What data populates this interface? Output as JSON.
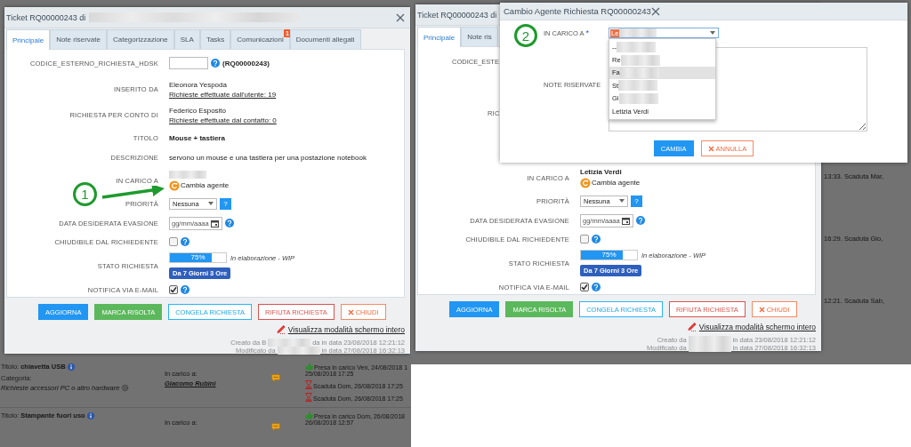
{
  "left": {
    "ticket": {
      "title": "Ticket RQ00000243 di",
      "title_redacted": true,
      "closable": true,
      "tabs": [
        {
          "label": "Principale",
          "selected": true
        },
        {
          "label": "Note riservate",
          "selected": false
        },
        {
          "label": "Categorizzazione",
          "selected": false
        },
        {
          "label": "SLA",
          "selected": false
        },
        {
          "label": "Tasks",
          "selected": false
        },
        {
          "label": "Comunicazioni",
          "selected": false,
          "badge": "1"
        },
        {
          "label": "Documenti allegati",
          "selected": false
        }
      ],
      "rows": [
        {
          "label": "CODICE_ESTERNO_RICHIESTA_HDSK",
          "kind": "code",
          "value": "(RQ00000243)"
        },
        {
          "label": "INSERITO DA",
          "kind": "person",
          "name": "Eleonora Yespoda",
          "link": "Richieste effettuate dall'utente: 19"
        },
        {
          "label": "RICHIESTA PER CONTO DI",
          "kind": "person",
          "name": "Federico Esposito",
          "link": "Richieste effettuate dal contatto: 0"
        },
        {
          "label": "TITOLO",
          "kind": "bold",
          "value": "Mouse + tastiera"
        },
        {
          "label": "DESCRIZIONE",
          "kind": "text",
          "value": "servono un mouse e una tastiera per una postazione notebook"
        },
        {
          "label": "IN CARICO A",
          "kind": "agent",
          "action": "Cambia agente"
        },
        {
          "label": "PRIORITÀ",
          "kind": "select",
          "value": "Nessuna",
          "help": "?"
        },
        {
          "label": "DATA DESIDERATA EVASIONE",
          "kind": "date",
          "placeholder": "gg/mm/aaaa"
        },
        {
          "label": "CHIUDIBILE DAL RICHIEDENTE",
          "kind": "checkbox",
          "checked": false
        },
        {
          "label": "STATO RICHIESTA",
          "kind": "progress",
          "level": 0.75,
          "reading": "75%",
          "status": "In elaborazione - WIP",
          "age": "Da 7 Giorni 3 Ore"
        },
        {
          "label": "NOTIFICA VIA E-MAIL",
          "kind": "checkbox",
          "checked": true
        }
      ],
      "buttons": [
        {
          "label": "AGGIORNA",
          "kind": "primary"
        },
        {
          "label": "MARCA RISOLTA",
          "kind": "success"
        },
        {
          "label": "CONGELA RICHIESTA",
          "kind": "info"
        },
        {
          "label": "RIFIUTA RICHIESTA",
          "kind": "danger"
        },
        {
          "label": "CHIUDI",
          "kind": "close"
        }
      ],
      "fullscreen_link": "Visualizza modalità schermo intero",
      "footer": [
        {
          "before": "Creato da B",
          "after": "da in data 23/08/2018 12:21:12"
        },
        {
          "before": "Modificato da",
          "after": "in data 27/08/2018 16:32:13"
        }
      ]
    },
    "annotation": {
      "number": "1",
      "kind": "pointer"
    },
    "background": {
      "rows": [
        {
          "title_label": "Titolo:",
          "title": "chiavetta USB",
          "category_label": "Categoria:",
          "category": "Richieste accessori PC o altro hardware",
          "assignee_label": "In carico a:",
          "assignee": "Giacomo Rubini",
          "events": [
            {
              "kind": "taken",
              "text": "Presa in carico Ven, 24/08/2018 1"
            },
            {
              "kind": "continuation",
              "text": "25/08/2018 17:25"
            },
            {
              "kind": "expired",
              "text": "Scaduta Dom, 26/08/2018 17:25"
            },
            {
              "kind": "expired",
              "text": "Scaduta Dom, 26/08/2018 17:25"
            }
          ]
        },
        {
          "title_label": "Titolo:",
          "title": "Stampante fuori uso",
          "assignee_label": "In carico a:",
          "events": [
            {
              "kind": "taken",
              "text": "Presa in carico Dom, 26/08/2018"
            },
            {
              "kind": "continuation",
              "text": "26/08/2018 12:57"
            }
          ]
        }
      ]
    }
  },
  "right": {
    "ticket": {
      "title": "Ticket RQ00000243 di",
      "tabs": [
        {
          "label": "Principale",
          "selected": true
        },
        {
          "label": "Note ris",
          "selected": false
        }
      ],
      "covered_labels": [
        "CODICE_ESTE",
        "RIC"
      ],
      "rows": [
        {
          "label": "IN CARICO A",
          "kind": "agent",
          "name": "Letizia Verdi",
          "action": "Cambia agente"
        },
        {
          "label": "PRIORITÀ",
          "kind": "select",
          "value": "Nessuna",
          "help": "?"
        },
        {
          "label": "DATA DESIDERATA EVASIONE",
          "kind": "date",
          "placeholder": "gg/mm/aaaa"
        },
        {
          "label": "CHIUDIBILE DAL RICHIEDENTE",
          "kind": "checkbox",
          "checked": false
        },
        {
          "label": "STATO RICHIESTA",
          "kind": "progress",
          "level": 0.75,
          "reading": "75%",
          "status": "In elaborazione - WIP",
          "age": "Da 7 Giorni 3 Ore"
        },
        {
          "label": "NOTIFICA VIA E-MAIL",
          "kind": "checkbox",
          "checked": true
        }
      ],
      "buttons": [
        {
          "label": "AGGIORNA",
          "kind": "primary"
        },
        {
          "label": "MARCA RISOLTA",
          "kind": "success"
        },
        {
          "label": "CONGELA RICHIESTA",
          "kind": "info"
        },
        {
          "label": "RIFIUTA RICHIESTA",
          "kind": "danger"
        },
        {
          "label": "CHIUDI",
          "kind": "close"
        }
      ],
      "fullscreen_link": "Visualizza modalità schermo intero",
      "footer": [
        {
          "before": "Creato da",
          "after": "in data 23/08/2018 12:21:12"
        },
        {
          "before": "Modificato da",
          "after": "in data 27/08/2018 16:32:13"
        }
      ]
    },
    "side_notes": [
      "13:33. Scaduta Mar,",
      "16:29. Scaduta Gio,",
      "12:21. Scaduta Sab,"
    ],
    "cambio": {
      "title": "Cambio Agente Richiesta RQ00000243",
      "annotation": {
        "number": "2"
      },
      "field_label": "IN CARICO A",
      "required_mark": "*",
      "select_value": "Le",
      "options": [
        {
          "label": "--",
          "selected": false
        },
        {
          "label": "Re",
          "selected": false
        },
        {
          "label": "Fa",
          "selected": true
        },
        {
          "label": "St",
          "selected": false
        },
        {
          "label": "Gi",
          "selected": false
        },
        {
          "label": "Letizia Verdi",
          "selected": false
        }
      ],
      "notes_label": "NOTE RISERVATE",
      "buttons": [
        {
          "label": "CAMBIA",
          "kind": "primary"
        },
        {
          "label": "ANNULLA",
          "kind": "close"
        }
      ]
    }
  }
}
